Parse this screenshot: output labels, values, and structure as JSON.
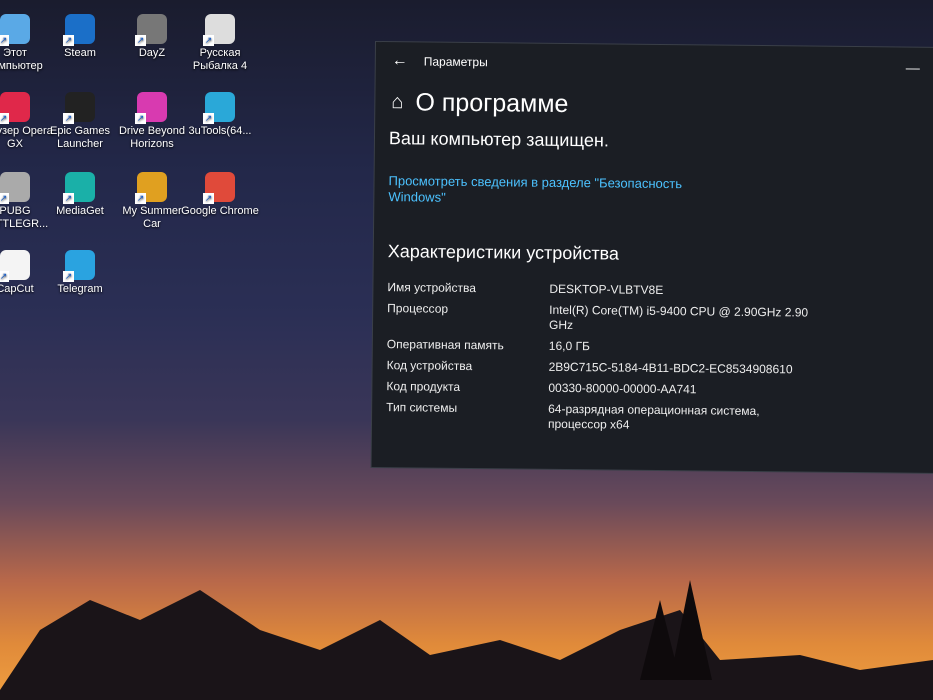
{
  "desktop": {
    "icons": [
      {
        "label": "Этот компьютер",
        "color": "#5aa9e6"
      },
      {
        "label": "Steam",
        "color": "#1b6fc8"
      },
      {
        "label": "DayZ",
        "color": "#777"
      },
      {
        "label": "Русская Рыбалка 4",
        "color": "#ddd"
      },
      {
        "label": "Браузер Opera GX",
        "color": "#e0284a"
      },
      {
        "label": "Epic Games Launcher",
        "color": "#222"
      },
      {
        "label": "Drive Beyond Horizons",
        "color": "#d83ab0"
      },
      {
        "label": "3uTools(64...",
        "color": "#2aa8d8"
      },
      {
        "label": "PUBG BATTLEGR...",
        "color": "#aaa"
      },
      {
        "label": "MediaGet",
        "color": "#1ab0a8"
      },
      {
        "label": "My Summer Car",
        "color": "#e0a020"
      },
      {
        "label": "Google Chrome",
        "color": "#e04a3a"
      },
      {
        "label": "CapCut",
        "color": "#f4f4f4"
      },
      {
        "label": "Telegram",
        "color": "#2aa3e0"
      }
    ]
  },
  "window": {
    "title": "Параметры",
    "page_title": "О программе",
    "protected": "Ваш компьютер защищен.",
    "security_link": "Просмотреть сведения в разделе \"Безопасность Windows\"",
    "specs_title": "Характеристики устройства",
    "specs": [
      {
        "key": "Имя устройства",
        "value": "DESKTOP-VLBTV8E"
      },
      {
        "key": "Процессор",
        "value": "Intel(R) Core(TM) i5-9400 CPU @ 2.90GHz 2.90 GHz"
      },
      {
        "key": "Оперативная память",
        "value": "16,0 ГБ"
      },
      {
        "key": "Код устройства",
        "value": "2B9C715C-5184-4B11-BDC2-EC8534908610"
      },
      {
        "key": "Код продукта",
        "value": "00330-80000-00000-AA741"
      },
      {
        "key": "Тип системы",
        "value": "64-разрядная операционная система, процессор x64"
      }
    ]
  }
}
